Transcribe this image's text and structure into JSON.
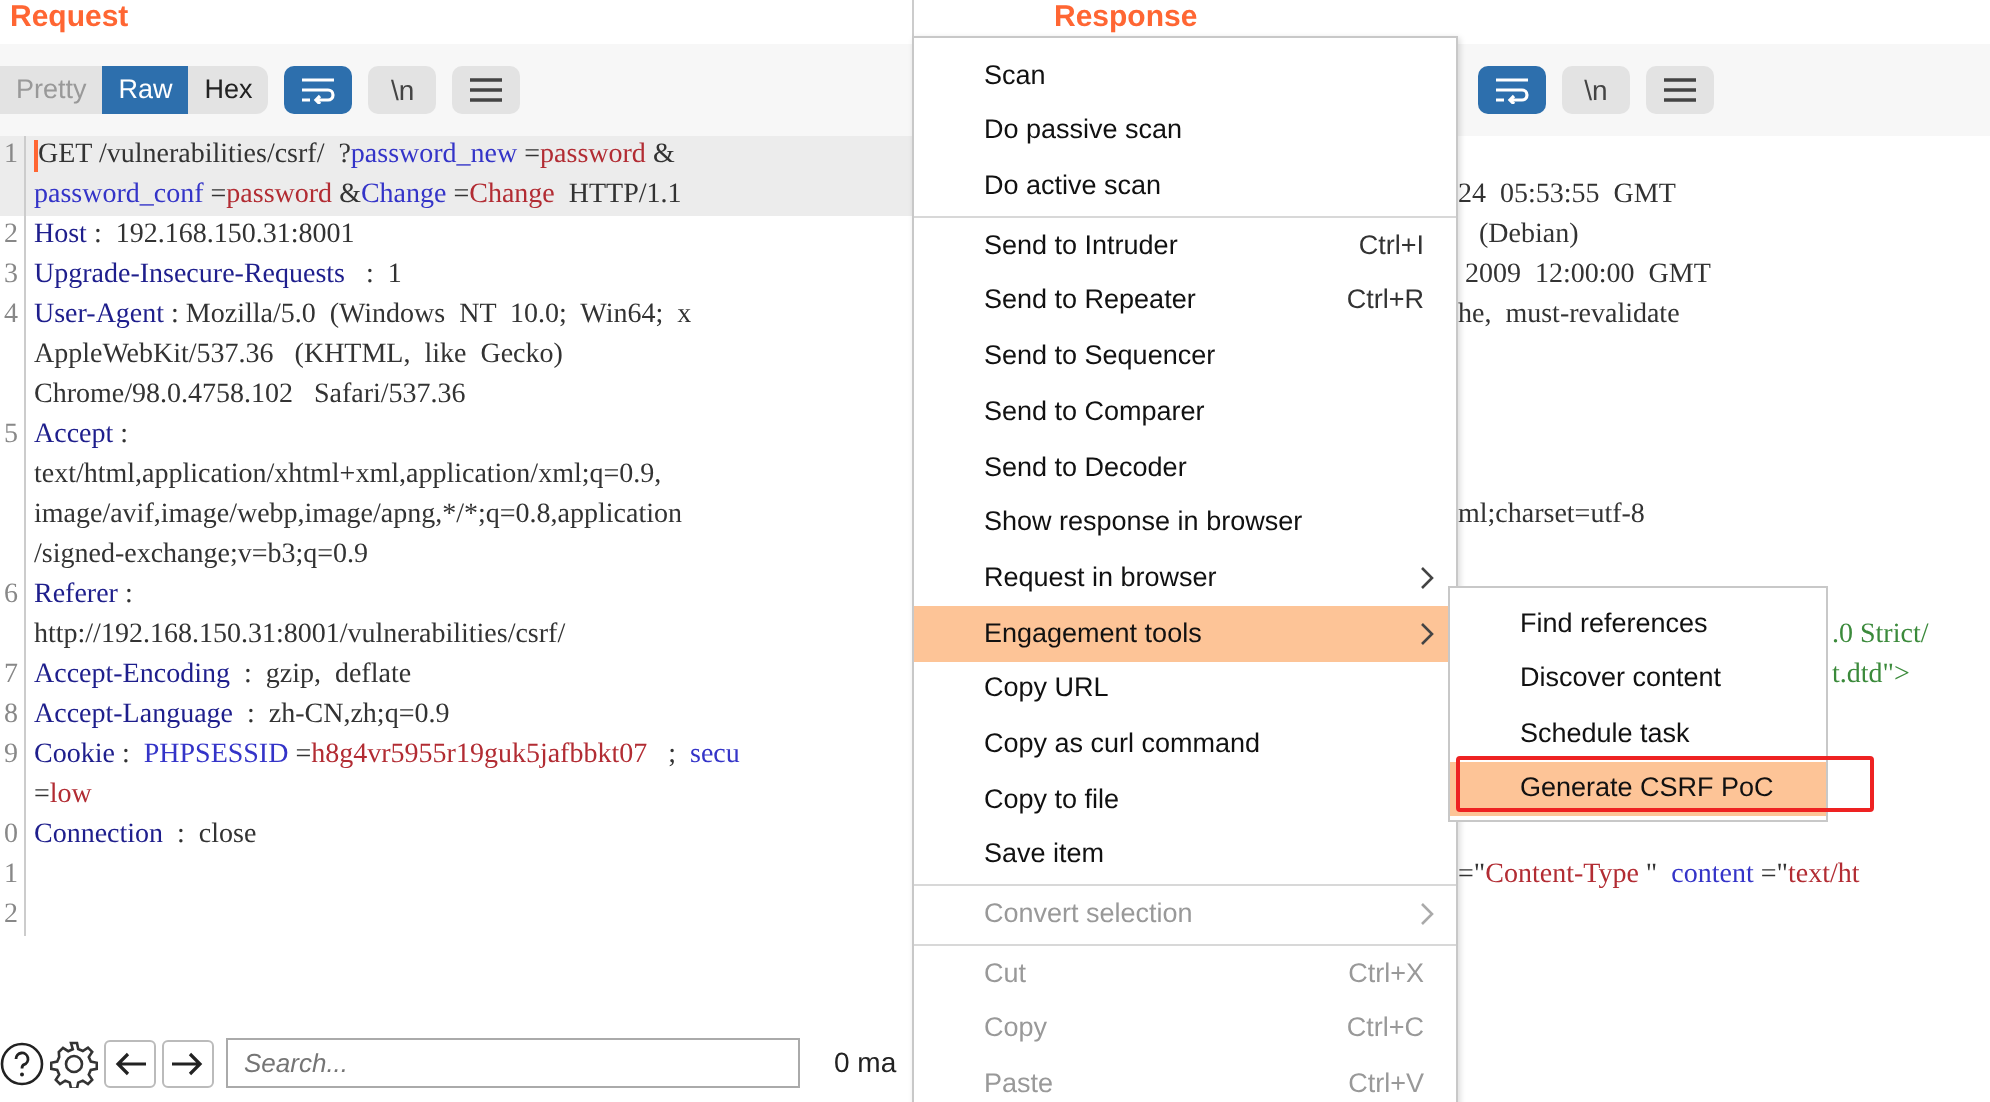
{
  "request": {
    "title": "Request",
    "view_tabs": [
      {
        "label": "Pretty",
        "selected": false,
        "disabled": true
      },
      {
        "label": "Raw",
        "selected": true,
        "disabled": false
      },
      {
        "label": "Hex",
        "selected": false,
        "disabled": false
      }
    ],
    "tools": [
      {
        "kind": "wrap",
        "selected": true
      },
      {
        "kind": "newline",
        "label": "\\n",
        "selected": false
      },
      {
        "kind": "menu",
        "selected": false
      }
    ],
    "lines": [
      {
        "number": "1",
        "current": true,
        "rows": [
          {
            "segments": [
              {
                "text": "GET /vulnerabilities/csrf/  ?",
                "kind": "plain"
              },
              {
                "text": "password_new",
                "kind": "param"
              },
              {
                "text": " =",
                "kind": "plain"
              },
              {
                "text": "password",
                "kind": "value"
              },
              {
                "text": " &",
                "kind": "plain"
              }
            ]
          },
          {
            "segments": [
              {
                "text": "password_conf",
                "kind": "param"
              },
              {
                "text": " =",
                "kind": "plain"
              },
              {
                "text": "password",
                "kind": "value"
              },
              {
                "text": " &",
                "kind": "plain"
              },
              {
                "text": "Change",
                "kind": "param"
              },
              {
                "text": " =",
                "kind": "plain"
              },
              {
                "text": "Change",
                "kind": "value"
              },
              {
                "text": "  HTTP/1.1",
                "kind": "plain"
              }
            ]
          }
        ]
      },
      {
        "number": "2",
        "current": false,
        "rows": [
          {
            "segments": [
              {
                "text": "Host",
                "kind": "header"
              },
              {
                "text": " :  192.168.150.31:8001",
                "kind": "plain"
              }
            ]
          }
        ]
      },
      {
        "number": "3",
        "current": false,
        "rows": [
          {
            "segments": [
              {
                "text": "Upgrade-Insecure-Requests",
                "kind": "header"
              },
              {
                "text": "   :  1",
                "kind": "plain"
              }
            ]
          }
        ]
      },
      {
        "number": "4",
        "current": false,
        "rows": [
          {
            "segments": [
              {
                "text": "User-Agent",
                "kind": "header"
              },
              {
                "text": " : Mozilla/5.0  (Windows  NT  10.0;  Win64;  x",
                "kind": "plain"
              }
            ]
          },
          {
            "segments": [
              {
                "text": "AppleWebKit/537.36   (KHTML,  like  Gecko)",
                "kind": "plain"
              }
            ]
          },
          {
            "segments": [
              {
                "text": "Chrome/98.0.4758.102   Safari/537.36",
                "kind": "plain"
              }
            ]
          }
        ]
      },
      {
        "number": "5",
        "current": false,
        "rows": [
          {
            "segments": [
              {
                "text": "Accept",
                "kind": "header"
              },
              {
                "text": " :",
                "kind": "plain"
              }
            ]
          },
          {
            "segments": [
              {
                "text": "text/html,application/xhtml+xml,application/xml;q=0.9,",
                "kind": "plain"
              }
            ]
          },
          {
            "segments": [
              {
                "text": "image/avif,image/webp,image/apng,*/*;q=0.8,application",
                "kind": "plain"
              }
            ]
          },
          {
            "segments": [
              {
                "text": "/signed-exchange;v=b3;q=0.9",
                "kind": "plain"
              }
            ]
          }
        ]
      },
      {
        "number": "6",
        "current": false,
        "rows": [
          {
            "segments": [
              {
                "text": "Referer",
                "kind": "header"
              },
              {
                "text": " :",
                "kind": "plain"
              }
            ]
          },
          {
            "segments": [
              {
                "text": "http://192.168.150.31:8001/vulnerabilities/csrf/",
                "kind": "plain"
              }
            ]
          }
        ]
      },
      {
        "number": "7",
        "current": false,
        "rows": [
          {
            "segments": [
              {
                "text": "Accept-Encoding",
                "kind": "header"
              },
              {
                "text": "  :  gzip,  deflate",
                "kind": "plain"
              }
            ]
          }
        ]
      },
      {
        "number": "8",
        "current": false,
        "rows": [
          {
            "segments": [
              {
                "text": "Accept-Language",
                "kind": "header"
              },
              {
                "text": "  :  zh-CN,zh;q=0.9",
                "kind": "plain"
              }
            ]
          }
        ]
      },
      {
        "number": "9",
        "current": false,
        "rows": [
          {
            "segments": [
              {
                "text": "Cookie",
                "kind": "header"
              },
              {
                "text": " :  ",
                "kind": "plain"
              },
              {
                "text": "PHPSESSID",
                "kind": "param"
              },
              {
                "text": " =",
                "kind": "plain"
              },
              {
                "text": "h8g4vr5955r19guk5jafbbkt07",
                "kind": "value"
              },
              {
                "text": "   ;  ",
                "kind": "plain"
              },
              {
                "text": "secu",
                "kind": "param"
              }
            ]
          },
          {
            "segments": [
              {
                "text": "=",
                "kind": "plain"
              },
              {
                "text": "low",
                "kind": "value"
              }
            ]
          }
        ]
      },
      {
        "number": "0",
        "current": false,
        "rows": [
          {
            "segments": [
              {
                "text": "Connection",
                "kind": "header"
              },
              {
                "text": "  :  close",
                "kind": "plain"
              }
            ]
          }
        ]
      },
      {
        "number": "1",
        "current": false
      },
      {
        "number": "2",
        "current": false
      }
    ],
    "search": {
      "placeholder": "Search..."
    },
    "match_count": "0 ma"
  },
  "response": {
    "title": "Response",
    "tools": [
      {
        "kind": "wrap",
        "selected": true
      },
      {
        "kind": "newline",
        "label": "\\n",
        "selected": false
      },
      {
        "kind": "menu",
        "selected": false
      }
    ],
    "lines": [
      {
        "segments": [
          {
            "text": "24  05:53:55  GMT",
            "kind": "plain"
          }
        ]
      },
      {
        "segments": [
          {
            "text": "   (Debian)",
            "kind": "plain"
          }
        ]
      },
      {
        "segments": [
          {
            "text": " 2009  12:00:00  GMT",
            "kind": "plain"
          }
        ]
      },
      {
        "segments": [
          {
            "text": "he,  must-revalidate",
            "kind": "plain"
          }
        ]
      },
      {
        "segments": [
          {
            "text": "ml;charset=utf-8",
            "kind": "plain"
          }
        ]
      },
      {
        "segments": [
          {
            "text": ".0 Strict/",
            "kind": "doctype"
          }
        ]
      },
      {
        "segments": [
          {
            "text": "t.dtd\">",
            "kind": "doctype"
          }
        ]
      },
      {
        "segments": [
          {
            "text": "=\"",
            "kind": "plain"
          },
          {
            "text": "Content-Type ",
            "kind": "value"
          },
          {
            "text": "\"  ",
            "kind": "plain"
          },
          {
            "text": "content",
            "kind": "param"
          },
          {
            "text": " =\"",
            "kind": "plain"
          },
          {
            "text": "text/ht",
            "kind": "value"
          }
        ]
      }
    ]
  },
  "context_menu": {
    "groups": [
      [
        {
          "label": "Scan",
          "selected": false,
          "disabled": false
        },
        {
          "label": "Do passive scan",
          "selected": false,
          "disabled": false
        },
        {
          "label": "Do active scan",
          "selected": false,
          "disabled": false
        }
      ],
      [
        {
          "label": "Send to Intruder",
          "shortcut": "Ctrl+I",
          "selected": false,
          "disabled": false
        },
        {
          "label": "Send to Repeater",
          "shortcut": "Ctrl+R",
          "selected": false,
          "disabled": false
        },
        {
          "label": "Send to Sequencer",
          "selected": false,
          "disabled": false
        },
        {
          "label": "Send to Comparer",
          "selected": false,
          "disabled": false
        },
        {
          "label": "Send to Decoder",
          "selected": false,
          "disabled": false
        },
        {
          "label": "Show response in browser",
          "selected": false,
          "disabled": false
        },
        {
          "label": "Request in browser",
          "submenu": true,
          "selected": false,
          "disabled": false
        },
        {
          "label": "Engagement tools",
          "submenu": true,
          "selected": true,
          "disabled": false
        },
        {
          "label": "Copy URL",
          "selected": false,
          "disabled": false
        },
        {
          "label": "Copy as curl command",
          "selected": false,
          "disabled": false
        },
        {
          "label": "Copy to file",
          "selected": false,
          "disabled": false
        },
        {
          "label": "Save item",
          "selected": false,
          "disabled": false
        }
      ],
      [
        {
          "label": "Convert selection",
          "submenu": true,
          "selected": false,
          "disabled": true
        }
      ],
      [
        {
          "label": "Cut",
          "shortcut": "Ctrl+X",
          "selected": false,
          "disabled": true
        },
        {
          "label": "Copy",
          "shortcut": "Ctrl+C",
          "selected": false,
          "disabled": true
        },
        {
          "label": "Paste",
          "shortcut": "Ctrl+V",
          "selected": false,
          "disabled": true
        }
      ]
    ]
  },
  "submenu": {
    "items": [
      {
        "label": "Find references",
        "selected": false,
        "annotated": false
      },
      {
        "label": "Discover content",
        "selected": false,
        "annotated": false
      },
      {
        "label": "Schedule task",
        "selected": false,
        "annotated": false
      },
      {
        "label": "Generate CSRF PoC",
        "selected": true,
        "annotated": true
      }
    ]
  }
}
